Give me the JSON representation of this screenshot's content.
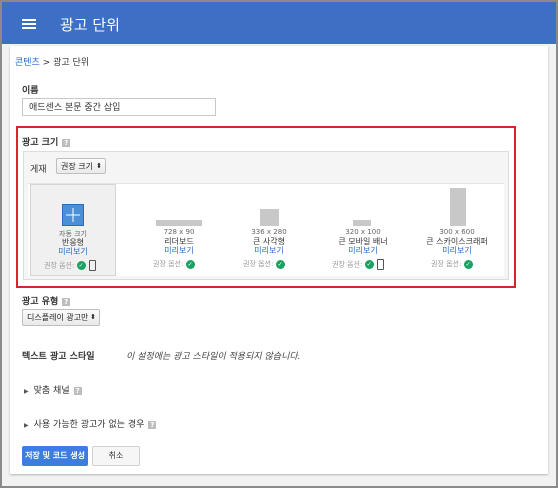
{
  "appbar": {
    "title": "광고 단위"
  },
  "breadcrumb": {
    "link": "콘텐츠",
    "separator": " > ",
    "current": "광고 단위"
  },
  "name": {
    "label": "이름",
    "value": "애드센스 본문 중간 삽입"
  },
  "ad_size": {
    "label": "광고 크기",
    "platform_label": "게재",
    "platform_value": "권장 크기",
    "options": [
      {
        "dims": "자동 크기",
        "name": "반응형",
        "preview": "미리보기",
        "rec": "권장 옵션:",
        "mobile": true,
        "selected": true
      },
      {
        "dims": "728 x 90",
        "name": "리더보드",
        "preview": "미리보기",
        "rec": "권장 옵션:",
        "mobile": false,
        "selected": false
      },
      {
        "dims": "336 x 280",
        "name": "큰 사각형",
        "preview": "미리보기",
        "rec": "권장 옵션:",
        "mobile": false,
        "selected": false
      },
      {
        "dims": "320 x 100",
        "name": "큰 모바일 배너",
        "preview": "미리보기",
        "rec": "권장 옵션:",
        "mobile": true,
        "selected": false
      },
      {
        "dims": "300 x 600",
        "name": "큰 스카이스크래퍼",
        "preview": "미리보기",
        "rec": "권장 옵션:",
        "mobile": false,
        "selected": false
      }
    ]
  },
  "ad_type": {
    "label": "광고 유형",
    "value": "디스플레이 광고만"
  },
  "text_style": {
    "label": "텍스트 광고 스타일",
    "note": "이 설정에는 광고 스타일이 적용되지 않습니다."
  },
  "custom_channels": {
    "label": "맞춤 채널"
  },
  "no_ads": {
    "label": "사용 가능한 광고가 없는 경우"
  },
  "buttons": {
    "save": "저장 및 코드 생성",
    "cancel": "취소"
  },
  "colors": {
    "appbar": "#3d6fc4",
    "highlight": "#d9232d",
    "link": "#2a66c9",
    "primary_button": "#3d7de0",
    "check": "#1aa260"
  }
}
